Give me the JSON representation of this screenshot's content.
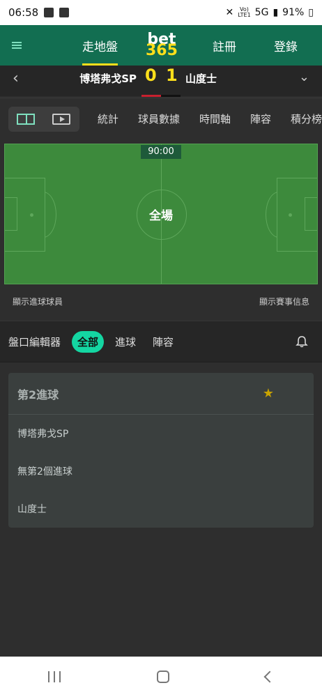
{
  "status_bar": {
    "time": "06:58",
    "network": "5G",
    "battery": "91%"
  },
  "top_nav": {
    "items": [
      "走地盤",
      "註冊",
      "登錄"
    ],
    "logo_top": "bet",
    "logo_bottom": "365"
  },
  "match": {
    "home_team": "博塔弗戈SP",
    "away_team": "山度士",
    "home_score": "0",
    "away_score": "1"
  },
  "tabs": [
    "統計",
    "球員數據",
    "時間軸",
    "陣容",
    "積分榜"
  ],
  "pitch": {
    "time": "90:00",
    "label": "全場"
  },
  "pitch_footer": {
    "left": "顯示進球球員",
    "right": "顯示賽事信息"
  },
  "filter_bar": {
    "editor": "盤口編輯器",
    "all": "全部",
    "goals": "進球",
    "lineup": "陣容"
  },
  "market": {
    "title": "第2進球",
    "options": [
      "博塔弗戈SP",
      "無第2個進球",
      "山度士"
    ]
  }
}
